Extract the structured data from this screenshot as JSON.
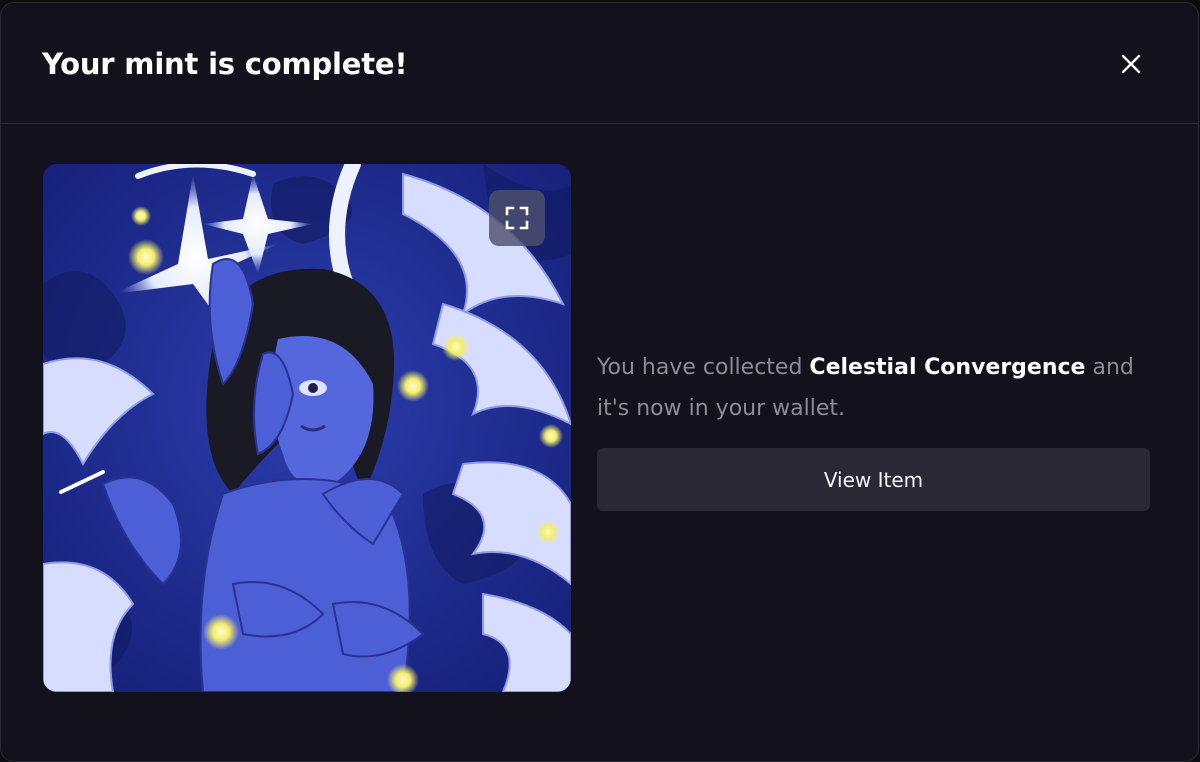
{
  "modal": {
    "title": "Your mint is complete!",
    "close_icon": "close-icon"
  },
  "artwork": {
    "expand_icon": "expand-icon",
    "palette": {
      "background": "#1d2a8a",
      "figure": "#4d5fd6",
      "hair": "#1a1a24",
      "wings": "#dfe3ff",
      "glow": "#fff7a0"
    }
  },
  "message": {
    "prefix": "You have collected ",
    "item_name": "Celestial Convergence",
    "suffix": " and it's now in your wallet."
  },
  "actions": {
    "view_item_label": "View Item"
  },
  "colors": {
    "background": "#13111b",
    "text_muted": "#8e8b99",
    "button_bg": "#2a2834"
  }
}
